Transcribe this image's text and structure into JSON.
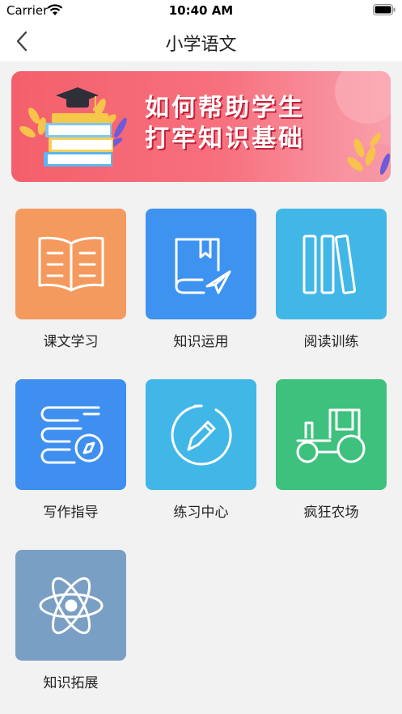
{
  "status": {
    "carrier": "Carrier",
    "time": "10:40 AM"
  },
  "header": {
    "title": "小学语文"
  },
  "banner": {
    "line1": "如何帮助学生",
    "line2": "打牢知识基础"
  },
  "grid": [
    {
      "label": "课文学习",
      "icon": "open-book-icon",
      "color": "#f59a5e"
    },
    {
      "label": "知识运用",
      "icon": "book-paper-plane-icon",
      "color": "#3e93f0"
    },
    {
      "label": "阅读训练",
      "icon": "books-icon",
      "color": "#41b7e8"
    },
    {
      "label": "写作指导",
      "icon": "books-compass-icon",
      "color": "#3e8ff0"
    },
    {
      "label": "练习中心",
      "icon": "pencil-circle-icon",
      "color": "#41b7e8"
    },
    {
      "label": "疯狂农场",
      "icon": "tractor-icon",
      "color": "#3ec17d"
    },
    {
      "label": "知识拓展",
      "icon": "atom-icon",
      "color": "#7a9fc4"
    }
  ]
}
